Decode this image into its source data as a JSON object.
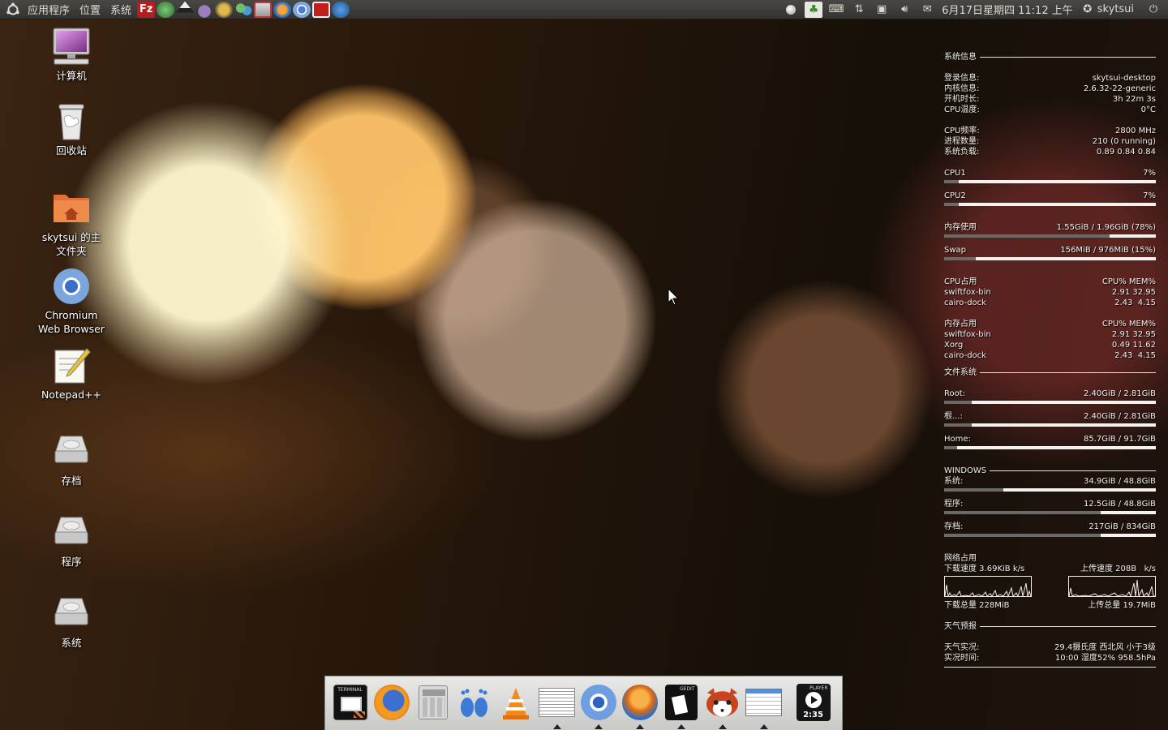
{
  "top_panel": {
    "menus": [
      "应用程序",
      "位置",
      "系统"
    ],
    "clock": "6月17日星期四 11:12 上午",
    "user": "skytsui",
    "launchers": [
      "filezilla-icon",
      "media-player-icon",
      "inkscape-icon",
      "pidgin-icon",
      "gimp-icon",
      "people-icon",
      "screenshot-icon",
      "swiftfox-icon",
      "chromium-icon",
      "terminal-red-icon",
      "update-icon"
    ],
    "tray": [
      "network-icon",
      "user-status-icon",
      "keyboard-icon",
      "transfer-icon",
      "security-icon",
      "volume-icon",
      "mail-icon"
    ]
  },
  "desktop": {
    "icons": [
      {
        "label": "计算机",
        "icon": "computer-icon"
      },
      {
        "label": "回收站",
        "icon": "trash-icon"
      },
      {
        "label": "skytsui 的主文件夹",
        "icon": "home-folder-icon"
      },
      {
        "label": "Chromium Web Browser",
        "icon": "chromium-icon"
      },
      {
        "label": "Notepad++",
        "icon": "notepad-icon"
      },
      {
        "label": "存档",
        "icon": "drive-icon"
      },
      {
        "label": "程序",
        "icon": "drive-icon"
      },
      {
        "label": "系统",
        "icon": "drive-icon"
      }
    ]
  },
  "conky": {
    "sysinfo_title": "系统信息",
    "login_label": "登录信息:",
    "login_value": "skytsui-desktop",
    "kernel_label": "内核信息:",
    "kernel_value": "2.6.32-22-generic",
    "uptime_label": "开机时长:",
    "uptime_value": "3h 22m 3s",
    "cputemp_label": "CPU温度:",
    "cputemp_value": "0°C",
    "cpufreq_label": "CPU频率:",
    "cpufreq_value": "2800 MHz",
    "procs_label": "进程数量:",
    "procs_value": "210 (0 running)",
    "load_label": "系统负载:",
    "load_value": "0.89 0.84 0.84",
    "cpu1_label": "CPU1",
    "cpu1_value": "7%",
    "cpu1_level": 0.07,
    "cpu2_label": "CPU2",
    "cpu2_value": "7%",
    "cpu2_level": 0.07,
    "mem_label": "内存使用",
    "mem_value": "1.55GiB / 1.96GiB (78%)",
    "mem_level": 0.78,
    "swap_label": "Swap",
    "swap_value": "156MiB / 976MiB (15%)",
    "swap_level": 0.15,
    "cpu_top_title": "CPU占用",
    "cpu_top_header": "CPU% MEM%",
    "cpu_top": [
      {
        "name": "swiftfox-bin",
        "value": "2.91 32.95"
      },
      {
        "name": "cairo-dock",
        "value": "2.43  4.15"
      }
    ],
    "mem_top_title": "内存占用",
    "mem_top_header": "CPU% MEM%",
    "mem_top": [
      {
        "name": "swiftfox-bin",
        "value": "2.91 32.95"
      },
      {
        "name": "Xorg",
        "value": "0.49 11.62"
      },
      {
        "name": "cairo-dock",
        "value": "2.43  4.15"
      }
    ],
    "fs_title": "文件系统",
    "fs": [
      {
        "name": "Root:",
        "value": "2.40GiB / 2.81GiB",
        "level": 0.13
      },
      {
        "name": "根...:",
        "value": "2.40GiB / 2.81GiB",
        "level": 0.13
      },
      {
        "name": "Home:",
        "value": "85.7GiB / 91.7GiB",
        "level": 0.06
      }
    ],
    "win_title": "WINDOWS",
    "win": [
      {
        "name": "系统:",
        "value": "34.9GiB / 48.8GiB",
        "level": 0.28
      },
      {
        "name": "程序:",
        "value": "12.5GiB / 48.8GiB",
        "level": 0.74
      },
      {
        "name": "存档:",
        "value": "217GiB / 834GiB",
        "level": 0.74
      }
    ],
    "net_title": "网络占用",
    "down_speed": "下载速度 3.69KiB k/s",
    "up_speed": "上传速度 208B   k/s",
    "down_total": "下载总量 228MiB",
    "up_total": "上传总量 19.7MiB",
    "weather_title": "天气预报",
    "weather_now_label": "天气实况:",
    "weather_now_value": "29.4摄氏度  西北风 小于3级",
    "weather_time_label": "实况时间:",
    "weather_time_value": "10:00  湿度52% 958.5hPa"
  },
  "dock": {
    "items": [
      "terminal-icon",
      "firefox-icon",
      "calculator-icon",
      "gnome-foot-icon",
      "vlc-icon",
      "text-editor-icon",
      "chromium-icon",
      "swiftfox-icon",
      "gedit-icon",
      "redpanda-icon",
      "file-manager-icon",
      "media-player-icon"
    ],
    "terminal_label": "TERMINAL",
    "gedit_label": "GEDIT",
    "player_label": "PLAYER",
    "player_time": "2:35"
  }
}
